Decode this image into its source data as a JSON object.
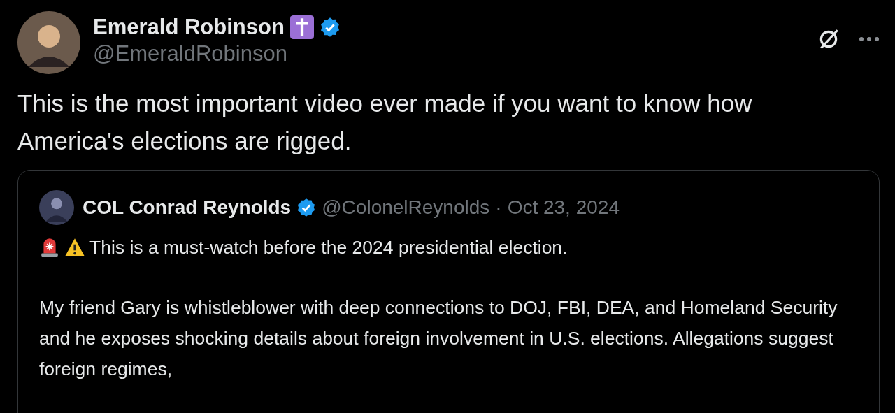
{
  "post": {
    "author": {
      "name": "Emerald Robinson",
      "handle": "@EmeraldRobinson",
      "verified": true,
      "badges": [
        {
          "kind": "cross"
        }
      ]
    },
    "text": "This is the most important video ever made if you want to know how America's elections are rigged.",
    "quoted": {
      "author": {
        "name": "COL Conrad Reynolds",
        "handle": "@ColonelReynolds",
        "verified": true
      },
      "separator": "·",
      "date": "Oct 23, 2024",
      "paragraphs": [
        {
          "icons": [
            {
              "kind": "siren"
            },
            {
              "kind": "warning"
            }
          ],
          "text": "This is a must-watch before the 2024 presidential election."
        },
        {
          "text": "My friend Gary is whistleblower with deep connections to DOJ, FBI, DEA, and Homeland Security and he exposes shocking details about foreign involvement in U.S. elections. Allegations suggest foreign regimes,"
        }
      ]
    }
  }
}
